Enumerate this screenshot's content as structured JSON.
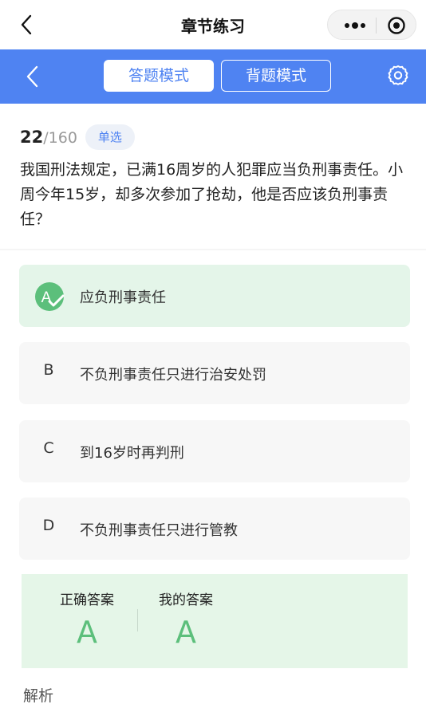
{
  "header": {
    "title": "章节练习"
  },
  "mode": {
    "answer_label": "答题模式",
    "recite_label": "背题模式"
  },
  "question": {
    "number": "22",
    "total": "/160",
    "type": "单选",
    "text": "我国刑法规定，已满16周岁的人犯罪应当负刑事责任。小周今年15岁，却多次参加了抢劫，他是否应该负刑事责任？"
  },
  "options": [
    {
      "letter": "A",
      "text": "应负刑事责任",
      "state": "correct"
    },
    {
      "letter": "B",
      "text": "不负刑事责任只进行治安处罚"
    },
    {
      "letter": "C",
      "text": "到16岁时再判刑"
    },
    {
      "letter": "D",
      "text": "不负刑事责任只进行管教"
    }
  ],
  "answer": {
    "correct_label": "正确答案",
    "correct_value": "A",
    "mine_label": "我的答案",
    "mine_value": "A"
  },
  "analysis_label": "解析",
  "colors": {
    "accent": "#4f83f2",
    "correct": "#5cbf7b",
    "correct_bg": "#e4f5e9"
  },
  "icons": [
    "back-icon",
    "more-icon",
    "target-icon",
    "gear-icon",
    "check-icon"
  ]
}
